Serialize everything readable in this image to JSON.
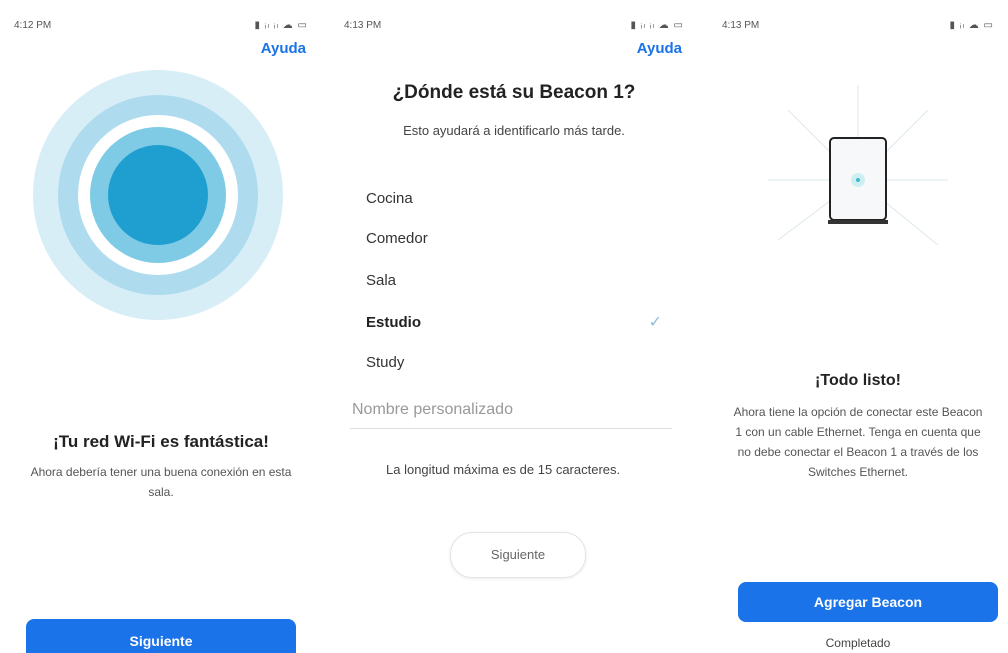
{
  "screen1": {
    "status": {
      "time": "4:12 PM",
      "icons": "▮ ᵢₗ ᵢₗ ☁ ▭"
    },
    "help": "Ayuda",
    "title": "¡Tu red Wi-Fi es fantástica!",
    "body": "Ahora debería tener una buena conexión en esta sala.",
    "button": "Siguiente"
  },
  "screen2": {
    "status": {
      "time": "4:13 PM",
      "icons": "▮ ᵢₗ ᵢₗ ☁ ▭"
    },
    "help": "Ayuda",
    "title": "¿Dónde está su Beacon 1?",
    "subtitle": "Esto ayudará a identificarlo más tarde.",
    "locations": [
      {
        "label": "Cocina",
        "selected": false
      },
      {
        "label": "Comedor",
        "selected": false
      },
      {
        "label": "Sala",
        "selected": false
      },
      {
        "label": "Estudio",
        "selected": true
      },
      {
        "label": "Study",
        "selected": false
      }
    ],
    "custom_placeholder": "Nombre personalizado",
    "note": "La longitud máxima es de 15 caracteres.",
    "button": "Siguiente"
  },
  "screen3": {
    "status": {
      "time": "4:13 PM",
      "icons": "▮ ᵢₗ ☁ ▭"
    },
    "title": "¡Todo listo!",
    "body": "Ahora tiene la opción de conectar este Beacon 1 con un cable Ethernet. Tenga en cuenta que no debe conectar el Beacon 1 a través de los Switches Ethernet.",
    "primary_button": "Agregar Beacon",
    "secondary_button": "Completado"
  },
  "colors": {
    "accent": "#1a73e8",
    "ring_inner": "#1f9fcf"
  }
}
